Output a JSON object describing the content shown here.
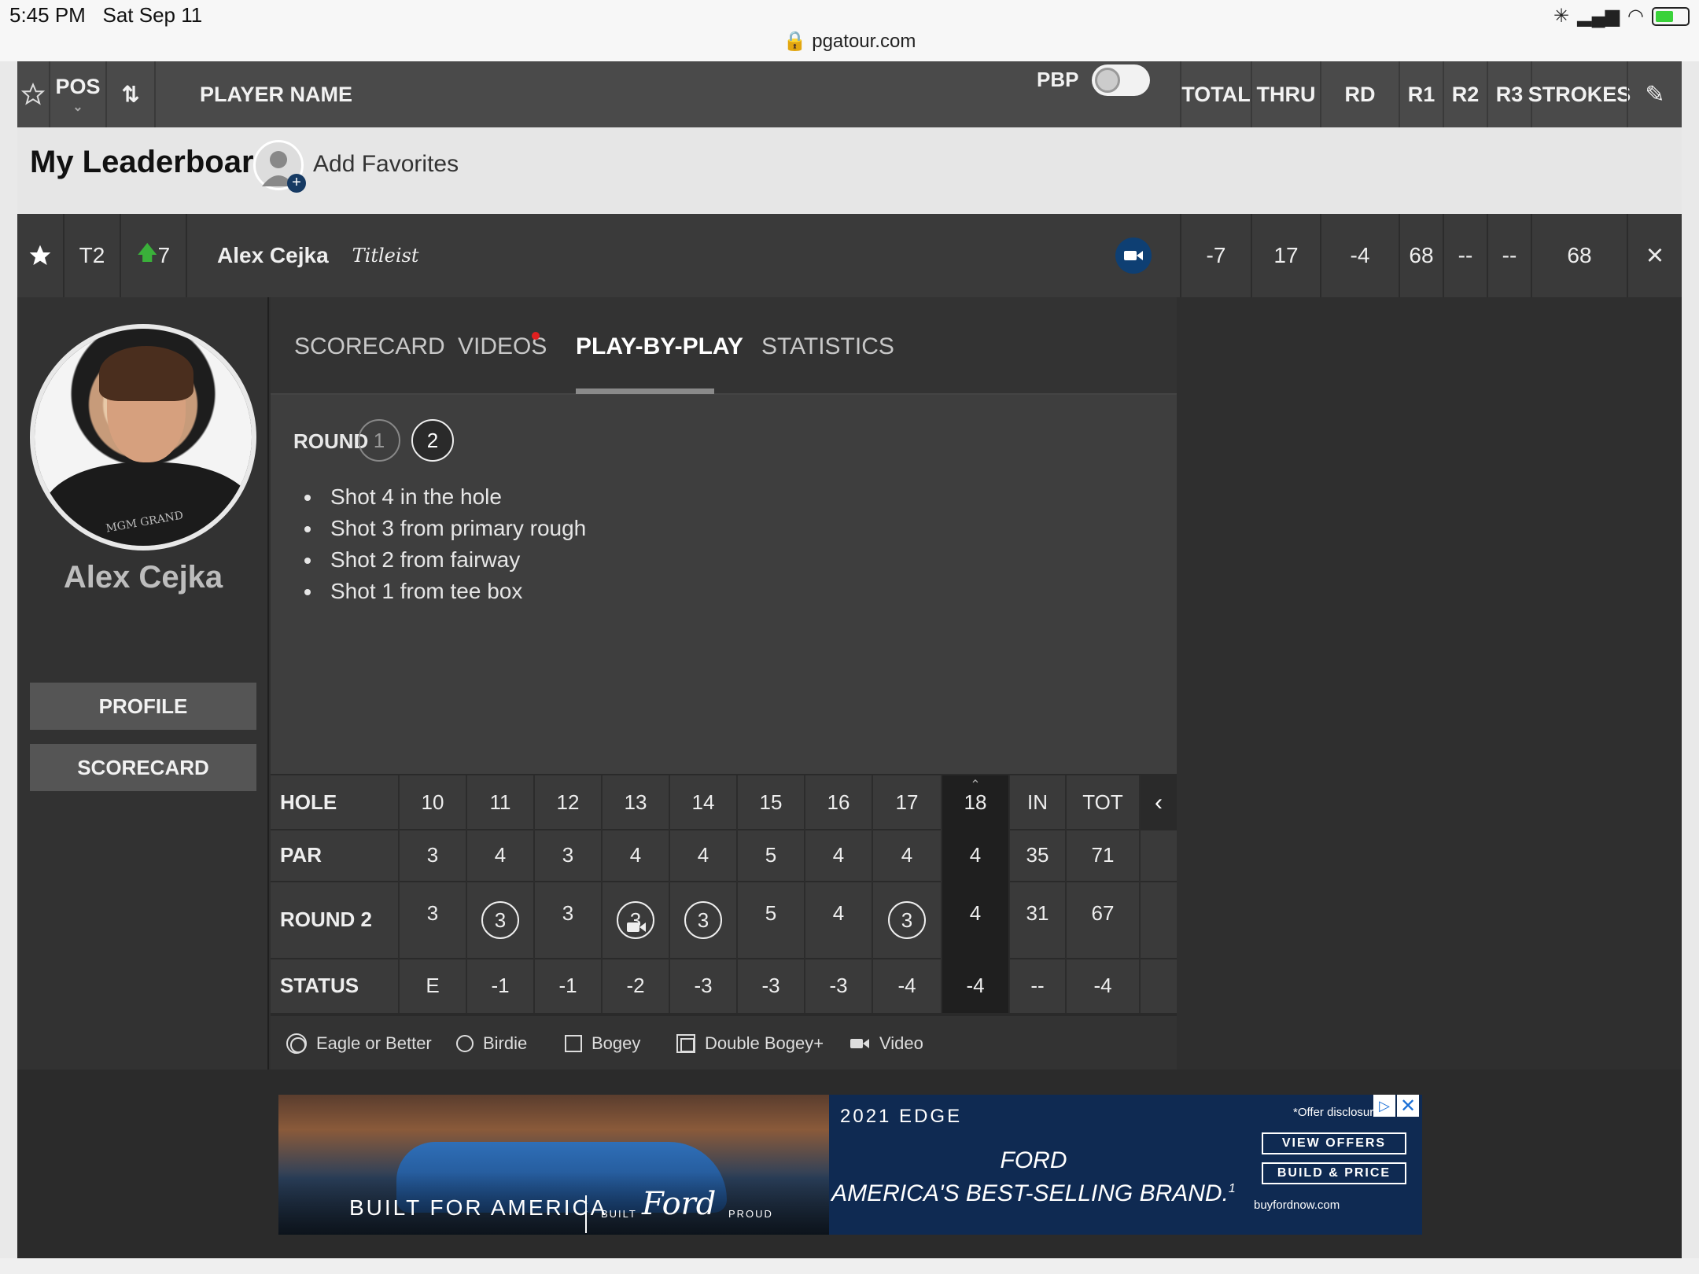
{
  "status_bar": {
    "time": "5:45 PM",
    "date": "Sat Sep 11",
    "url": "pgatour.com"
  },
  "header": {
    "pos": "POS",
    "player_name": "PLAYER NAME",
    "pbp": "PBP",
    "total": "TOTAL",
    "thru": "THRU",
    "rd": "RD",
    "r1": "R1",
    "r2": "R2",
    "r3": "R3",
    "strokes": "STROKES"
  },
  "my_leaderboard": {
    "title": "My Leaderboard",
    "add_favorites": "Add Favorites"
  },
  "player_row": {
    "pos": "T2",
    "movement": "7",
    "name": "Alex Cejka",
    "sponsor": "Titleist",
    "total": "-7",
    "thru": "17",
    "rd": "-4",
    "r1": "68",
    "r2": "--",
    "r3": "--",
    "strokes": "68"
  },
  "player_card": {
    "name": "Alex Cejka",
    "profile_btn": "PROFILE",
    "scorecard_btn": "SCORECARD",
    "shirt_logo": "MGM GRAND"
  },
  "tabs": [
    "SCORECARD",
    "VIDEOS",
    "PLAY-BY-PLAY",
    "STATISTICS"
  ],
  "active_tab": "PLAY-BY-PLAY",
  "play_by_play": {
    "round_label": "ROUND",
    "rounds": [
      "1",
      "2"
    ],
    "selected_round": "2",
    "shots": [
      "Shot 4 in the hole",
      "Shot 3 from primary rough",
      "Shot 2 from fairway",
      "Shot 1 from tee box"
    ]
  },
  "scorecard": {
    "labels": {
      "hole": "HOLE",
      "par": "PAR",
      "round": "ROUND 2",
      "status": "STATUS"
    },
    "holes": [
      "10",
      "11",
      "12",
      "13",
      "14",
      "15",
      "16",
      "17",
      "18",
      "IN",
      "TOT"
    ],
    "par": [
      "3",
      "4",
      "3",
      "4",
      "4",
      "5",
      "4",
      "4",
      "4",
      "35",
      "71"
    ],
    "round2": [
      "3",
      "3",
      "3",
      "3",
      "3",
      "5",
      "4",
      "3",
      "4",
      "31",
      "67"
    ],
    "birdies": [
      1,
      3,
      4,
      7
    ],
    "status": [
      "E",
      "-1",
      "-1",
      "-2",
      "-3",
      "-3",
      "-3",
      "-4",
      "-4",
      "--",
      "-4"
    ]
  },
  "legend": [
    "Eagle or Better",
    "Birdie",
    "Bogey",
    "Double Bogey+",
    "Video"
  ],
  "ad": {
    "model": "2021 EDGE",
    "tagline": "BUILT FOR AMERICA",
    "built": "BUILT",
    "brand": "Ford",
    "proud": "PROUD",
    "slogan_line1": "FORD",
    "slogan_line2": "AMERICA'S BEST-SELLING BRAND.",
    "footnote": "1",
    "disclosure": "*Offer disclosur",
    "btn1": "VIEW OFFERS",
    "btn2": "BUILD & PRICE",
    "url": "buyfordnow.com"
  }
}
